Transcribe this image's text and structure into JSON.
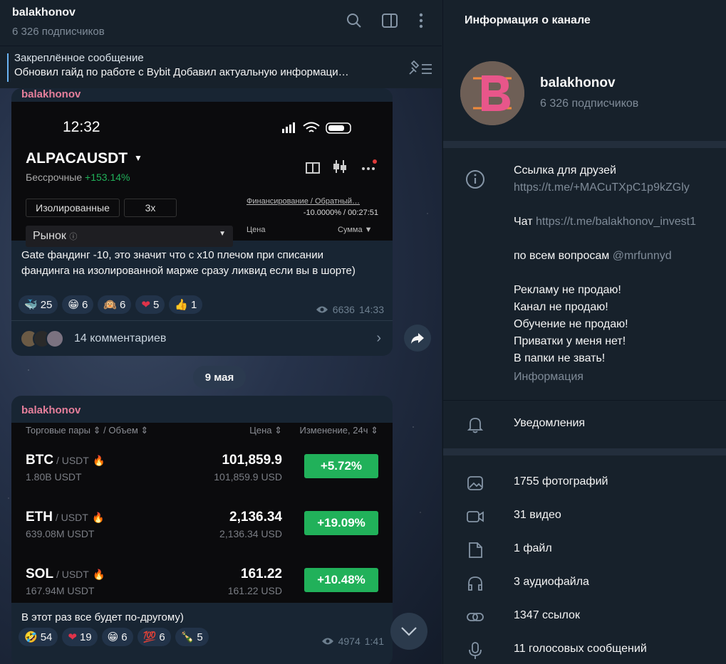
{
  "chat": {
    "title": "balakhonov",
    "subtitle": "6 326 подписчиков",
    "pinned_title": "Закреплённое сообщение",
    "pinned_text": "Обновил гайд по работе с Bybit  Добавил актуальную информаци…"
  },
  "msg1": {
    "author": "balakhonov",
    "phone": {
      "time": "12:32",
      "pair": "ALPACAUSDT",
      "perp": "Бессрочные",
      "perp_change": "+153.14%",
      "btn_isolated": "Изолированные",
      "btn_leverage": "3x",
      "funding_label": "Финансирование / Обратный…",
      "funding_value": "-10.0000% / 00:27:51",
      "market": "Рынок",
      "col_price": "Цена",
      "col_sum": "Сумма"
    },
    "caption": "Gate фандинг -10, это значит что с x10 плечом при списании фандинга на изолированной марже сразу ликвид если вы в шорте)",
    "reactions": [
      {
        "emoji": "🐳",
        "count": "25"
      },
      {
        "emoji": "😁",
        "count": "6"
      },
      {
        "emoji": "🙉",
        "count": "6"
      },
      {
        "emoji": "❤",
        "count": "5"
      },
      {
        "emoji": "👍",
        "count": "1"
      }
    ],
    "views": "6636",
    "time": "14:33",
    "comments": "14 комментариев"
  },
  "date_pill": "9 мая",
  "msg2": {
    "author": "balakhonov",
    "table_head": {
      "pairs": "Торговые пары ⇕ / Объем ⇕",
      "price": "Цена ⇕",
      "change": "Изменение, 24ч ⇕"
    },
    "rows": [
      {
        "coin": "BTC",
        "quote": " / USDT",
        "vol": "1.80B USDT",
        "price": "101,859.9",
        "price2": "101,859.9 USD",
        "change": "+5.72%"
      },
      {
        "coin": "ETH",
        "quote": " / USDT",
        "vol": "639.08M USDT",
        "price": "2,136.34",
        "price2": "2,136.34 USD",
        "change": "+19.09%"
      },
      {
        "coin": "SOL",
        "quote": " / USDT",
        "vol": "167.94M USDT",
        "price": "161.22",
        "price2": "161.22 USD",
        "change": "+10.48%"
      }
    ],
    "caption": "В этот раз все будет по-другому)",
    "reactions": [
      {
        "emoji": "🤣",
        "count": "54"
      },
      {
        "emoji": "❤",
        "count": "19"
      },
      {
        "emoji": "😁",
        "count": "6"
      },
      {
        "emoji": "💯",
        "count": "6"
      },
      {
        "emoji": "🍾",
        "count": "5"
      }
    ],
    "views": "4974",
    "time": "1:41"
  },
  "info": {
    "header": "Информация о канале",
    "name": "balakhonov",
    "subs": "6 326 подписчиков",
    "desc_lines": {
      "l1": "Ссылка для друзей",
      "l2": "https://t.me/+MACuTXpC1p9kZGly",
      "chat_label": "Чат ",
      "chat_link": "https://t.me/balakhonov_invest1",
      "ask_label": "по всем вопросам ",
      "ask_link": "@mrfunnyd",
      "l5": "Рекламу не продаю!",
      "l6": "Канал не продаю!",
      "l7": "Обучение не продаю!",
      "l8": "Приватки у меня нет!",
      "l9": "В папки не звать!",
      "caption": "Информация"
    },
    "notifications": "Уведомления",
    "media": [
      {
        "icon": "photo-icon",
        "label": "1755 фотографий"
      },
      {
        "icon": "video-icon",
        "label": "31 видео"
      },
      {
        "icon": "file-icon",
        "label": "1 файл"
      },
      {
        "icon": "headphones-icon",
        "label": "3 аудиофайла"
      },
      {
        "icon": "link-icon",
        "label": "1347 ссылок"
      },
      {
        "icon": "microphone-icon",
        "label": "11 голосовых сообщений"
      }
    ]
  },
  "colors": {
    "accent": "#6ab3f3",
    "author": "#e67f9b",
    "green": "#21b15a",
    "panel": "#17212b"
  }
}
